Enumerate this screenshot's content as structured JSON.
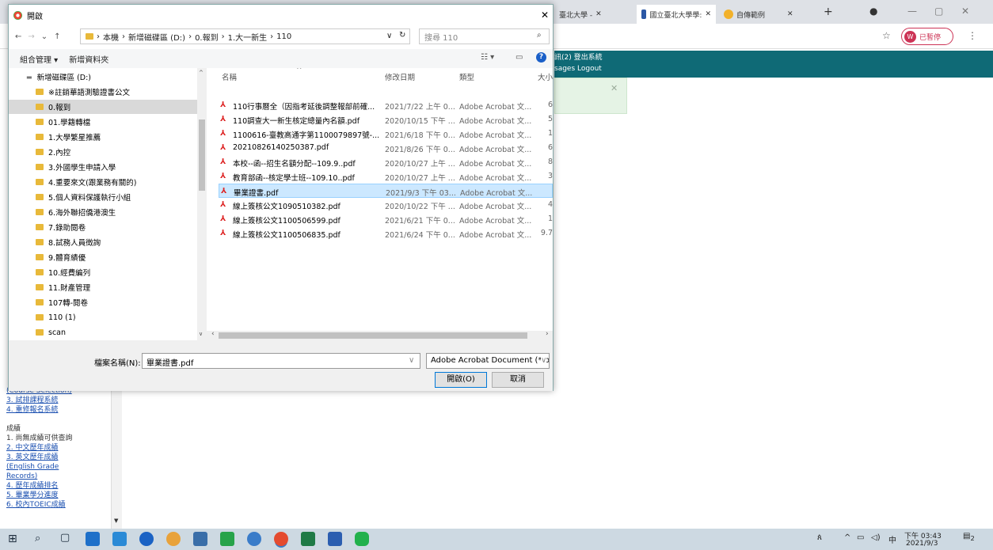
{
  "browser": {
    "tabs": [
      {
        "label": "臺北大學 -"
      },
      {
        "label": "國立臺北大學學:"
      },
      {
        "label": "自傳範例"
      }
    ],
    "profile_label": "已暫停",
    "profile_letter": "W"
  },
  "page": {
    "nav_top": "訊(2)  登出系統",
    "nav_bottom": "sages  Logout",
    "sidebar_lines": [
      {
        "text": "(Course Selection)",
        "link": true
      },
      {
        "text": "3. 試排課程系統",
        "link": true
      },
      {
        "text": "4. 重修報名系統",
        "link": true
      },
      {
        "text": "",
        "link": false
      },
      {
        "text": "成績",
        "link": false
      },
      {
        "text": "1. 尚無成績可供查詢",
        "link": false
      },
      {
        "text": "2. 中文歷年成績",
        "link": true
      },
      {
        "text": "3. 英文歷年成績",
        "link": true
      },
      {
        "text": "(English Grade",
        "link": true
      },
      {
        "text": "Records)",
        "link": true
      },
      {
        "text": "4. 歷年成績排名",
        "link": true
      },
      {
        "text": "5. 畢業學分進度",
        "link": true
      },
      {
        "text": "6. 校內TOEIC成績",
        "link": true
      }
    ]
  },
  "dialog": {
    "title": "開啟",
    "address_parts": [
      "本機",
      "新增磁碟區 (D:)",
      "0.報到",
      "1.大一新生",
      "110"
    ],
    "search_placeholder": "搜尋 110",
    "toolbar": {
      "organize": "組合管理 ▾",
      "new_folder": "新增資料夾"
    },
    "tree": [
      {
        "label": "新增磁碟區 (D:)",
        "drive": true,
        "selected": false
      },
      {
        "label": "※註銷華語測驗證書公文",
        "selected": false
      },
      {
        "label": "0.報到",
        "selected": true
      },
      {
        "label": "01.學籍轉檔",
        "selected": false
      },
      {
        "label": "1.大學繁星推薦",
        "selected": false
      },
      {
        "label": "2.內控",
        "selected": false
      },
      {
        "label": "3.外國學生申請入學",
        "selected": false
      },
      {
        "label": "4.重要來文(跟業務有關的)",
        "selected": false
      },
      {
        "label": "5.個人資料保護執行小組",
        "selected": false
      },
      {
        "label": "6.海外聯招僑港澳生",
        "selected": false
      },
      {
        "label": "7.錄助閱卷",
        "selected": false
      },
      {
        "label": "8.試務人員徵詢",
        "selected": false
      },
      {
        "label": "9.體育績優",
        "selected": false
      },
      {
        "label": "10.經費編列",
        "selected": false
      },
      {
        "label": "11.財產管理",
        "selected": false
      },
      {
        "label": "107轉-閱卷",
        "selected": false
      },
      {
        "label": "110 (1)",
        "selected": false
      },
      {
        "label": "scan",
        "selected": false
      }
    ],
    "columns": {
      "name": "名稱",
      "date": "修改日期",
      "type": "類型",
      "size": "大小"
    },
    "files": [
      {
        "name": "110行事曆全（因指考延後調整報部前確...",
        "date": "2021/7/22 上午 0...",
        "type": "Adobe Acrobat 文...",
        "size": "6",
        "selected": false
      },
      {
        "name": "110調查大一新生核定總量內名額.pdf",
        "date": "2020/10/15 下午 ...",
        "type": "Adobe Acrobat 文...",
        "size": "5",
        "selected": false
      },
      {
        "name": "1100616-臺教高通字第1100079897號-...",
        "date": "2021/6/18 下午 0...",
        "type": "Adobe Acrobat 文...",
        "size": "1",
        "selected": false
      },
      {
        "name": "20210826140250387.pdf",
        "date": "2021/8/26 下午 0...",
        "type": "Adobe Acrobat 文...",
        "size": "6",
        "selected": false
      },
      {
        "name": "本校--函--招生名額分配--109.9..pdf",
        "date": "2020/10/27 上午 ...",
        "type": "Adobe Acrobat 文...",
        "size": "8",
        "selected": false
      },
      {
        "name": "教育部函--核定學士班--109.10..pdf",
        "date": "2020/10/27 上午 ...",
        "type": "Adobe Acrobat 文...",
        "size": "3",
        "selected": false
      },
      {
        "name": "畢業證書.pdf",
        "date": "2021/9/3 下午 03...",
        "type": "Adobe Acrobat 文...",
        "size": "",
        "selected": true
      },
      {
        "name": "線上簽核公文1090510382.pdf",
        "date": "2020/10/22 下午 ...",
        "type": "Adobe Acrobat 文...",
        "size": "4",
        "selected": false
      },
      {
        "name": "線上簽核公文1100506599.pdf",
        "date": "2021/6/21 下午 0...",
        "type": "Adobe Acrobat 文...",
        "size": "1",
        "selected": false
      },
      {
        "name": "線上簽核公文1100506835.pdf",
        "date": "2021/6/24 下午 0...",
        "type": "Adobe Acrobat 文...",
        "size": "9.7",
        "selected": false
      }
    ],
    "filename_label": "檔案名稱(N):",
    "filename_value": "畢業證書.pdf",
    "filetype_value": "Adobe Acrobat Document (*.p",
    "open_button": "開啟(O)",
    "cancel_button": "取消"
  },
  "taskbar": {
    "ime": "中",
    "time": "下午 03:43",
    "date": "2021/9/3",
    "notif_count": "2"
  }
}
